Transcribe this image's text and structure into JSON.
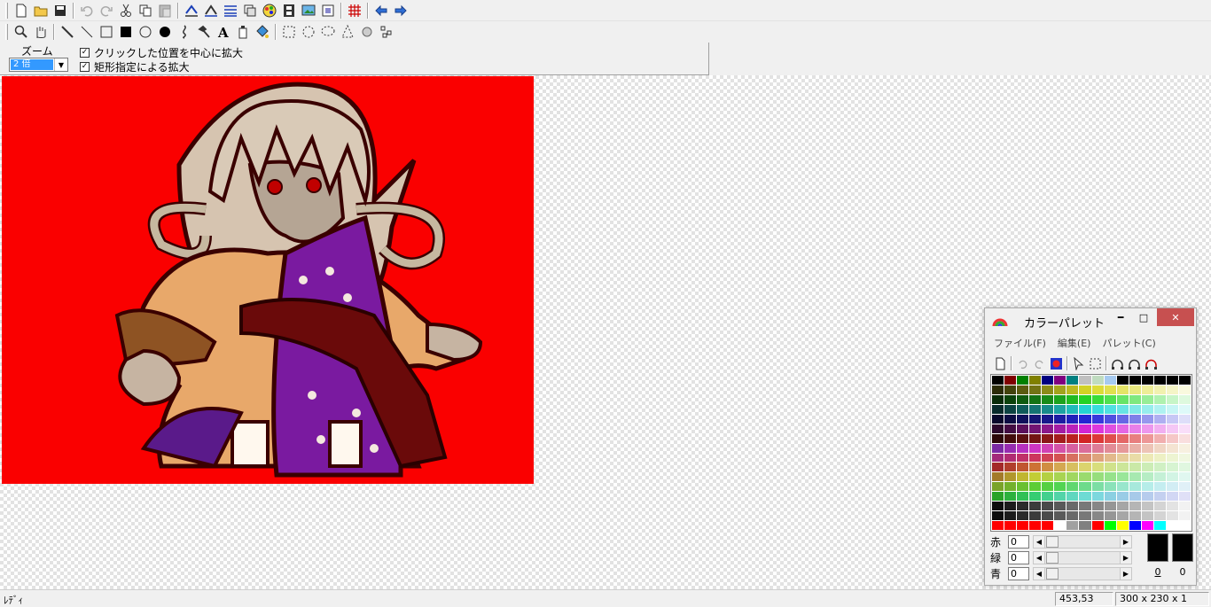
{
  "main_toolbar": {
    "buttons": [
      "new-file",
      "open-folder",
      "save",
      "undo",
      "redo",
      "cut",
      "copy",
      "paste",
      "flip",
      "rotate",
      "resize",
      "layer",
      "color-mode",
      "film",
      "image",
      "frame",
      "grid",
      "arrow-left",
      "arrow-right"
    ]
  },
  "draw_toolbar": {
    "tools": [
      "zoom",
      "hand",
      "pen",
      "line",
      "rect",
      "filled-rect",
      "circle",
      "filled-circle",
      "curve",
      "hammer",
      "text",
      "bucket",
      "fill",
      "rect-select",
      "ellipse-select",
      "lasso-select",
      "polygon-select",
      "spray",
      "dots"
    ]
  },
  "zoom_panel": {
    "label": "ズーム",
    "selected": "2 倍",
    "option_center": "クリックした位置を中心に拡大",
    "option_rect": "矩形指定による拡大",
    "option_center_checked": "✓",
    "option_rect_checked": "✓"
  },
  "palette_window": {
    "title": "カラーパレット",
    "menu": [
      "ファイル(F)",
      "編集(E)",
      "パレット(C)"
    ],
    "red_label": "赤",
    "green_label": "緑",
    "blue_label": "青",
    "red_value": "0",
    "green_value": "0",
    "blue_value": "0",
    "fg_index": "0",
    "bg_index": "0",
    "fg_color": "#000000",
    "bg_color": "#000000"
  },
  "canvas": {
    "background_color": "#fa0000"
  },
  "status": {
    "text": "ﾚﾃﾞｨ",
    "coords": "453,53",
    "size": "300 x 230 x 1"
  }
}
